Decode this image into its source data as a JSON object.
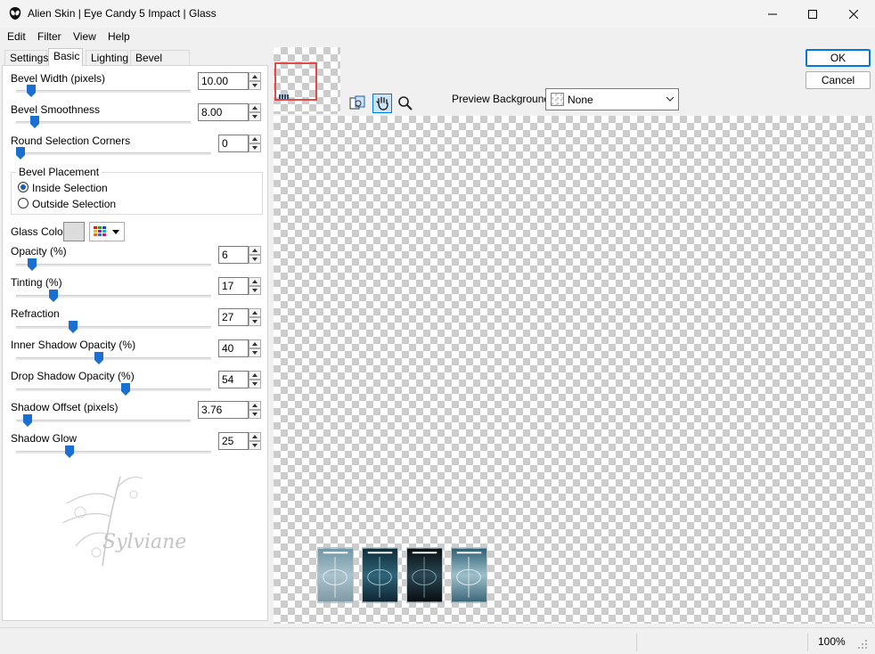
{
  "window": {
    "title": "Alien Skin | Eye Candy 5 Impact | Glass",
    "icons": {
      "app": "alien-skin-icon",
      "minimize": "minimize-icon",
      "maximize": "maximize-icon",
      "close": "close-icon"
    }
  },
  "menu": [
    {
      "label": "Edit"
    },
    {
      "label": "Filter"
    },
    {
      "label": "View"
    },
    {
      "label": "Help"
    }
  ],
  "tabs": [
    {
      "label": "Settings",
      "active": false
    },
    {
      "label": "Basic",
      "active": true
    },
    {
      "label": "Lighting",
      "active": false
    },
    {
      "label": "Bevel Profile",
      "active": false
    }
  ],
  "basic": {
    "bevel_width": {
      "label": "Bevel Width (pixels)",
      "value": "10.00",
      "level": 0.06
    },
    "bevel_smoothness": {
      "label": "Bevel Smoothness",
      "value": "8.00",
      "level": 0.08
    },
    "round_corners": {
      "label": "Round Selection Corners",
      "value": "0",
      "level": 0.0
    },
    "bevel_placement": {
      "title": "Bevel Placement",
      "options": [
        {
          "label": "Inside Selection",
          "selected": true
        },
        {
          "label": "Outside Selection",
          "selected": false
        }
      ]
    },
    "glass_color": {
      "label": "Glass Color",
      "swatch": "#dcdcdc"
    },
    "opacity": {
      "label": "Opacity (%)",
      "value": "6",
      "level": 0.06
    },
    "tinting": {
      "label": "Tinting (%)",
      "value": "17",
      "level": 0.17
    },
    "refraction": {
      "label": "Refraction",
      "value": "27",
      "level": 0.27
    },
    "inner_shadow": {
      "label": "Inner Shadow Opacity (%)",
      "value": "40",
      "level": 0.4
    },
    "drop_shadow": {
      "label": "Drop Shadow Opacity (%)",
      "value": "54",
      "level": 0.54
    },
    "shadow_offset": {
      "label": "Shadow Offset (pixels)",
      "value": "3.76",
      "level": 0.04
    },
    "shadow_glow": {
      "label": "Shadow Glow",
      "value": "25",
      "level": 0.25
    }
  },
  "watermark": {
    "text": "Sylviane"
  },
  "preview": {
    "background_label": "Preview Background:",
    "background_value": "None",
    "tools": [
      "compare-icon",
      "hand-icon",
      "zoom-icon"
    ]
  },
  "buttons": {
    "ok": "OK",
    "cancel": "Cancel"
  },
  "status": {
    "zoom": "100%"
  },
  "colors": {
    "accent": "#0078d4",
    "navigator_frame": "#e24a4a"
  }
}
